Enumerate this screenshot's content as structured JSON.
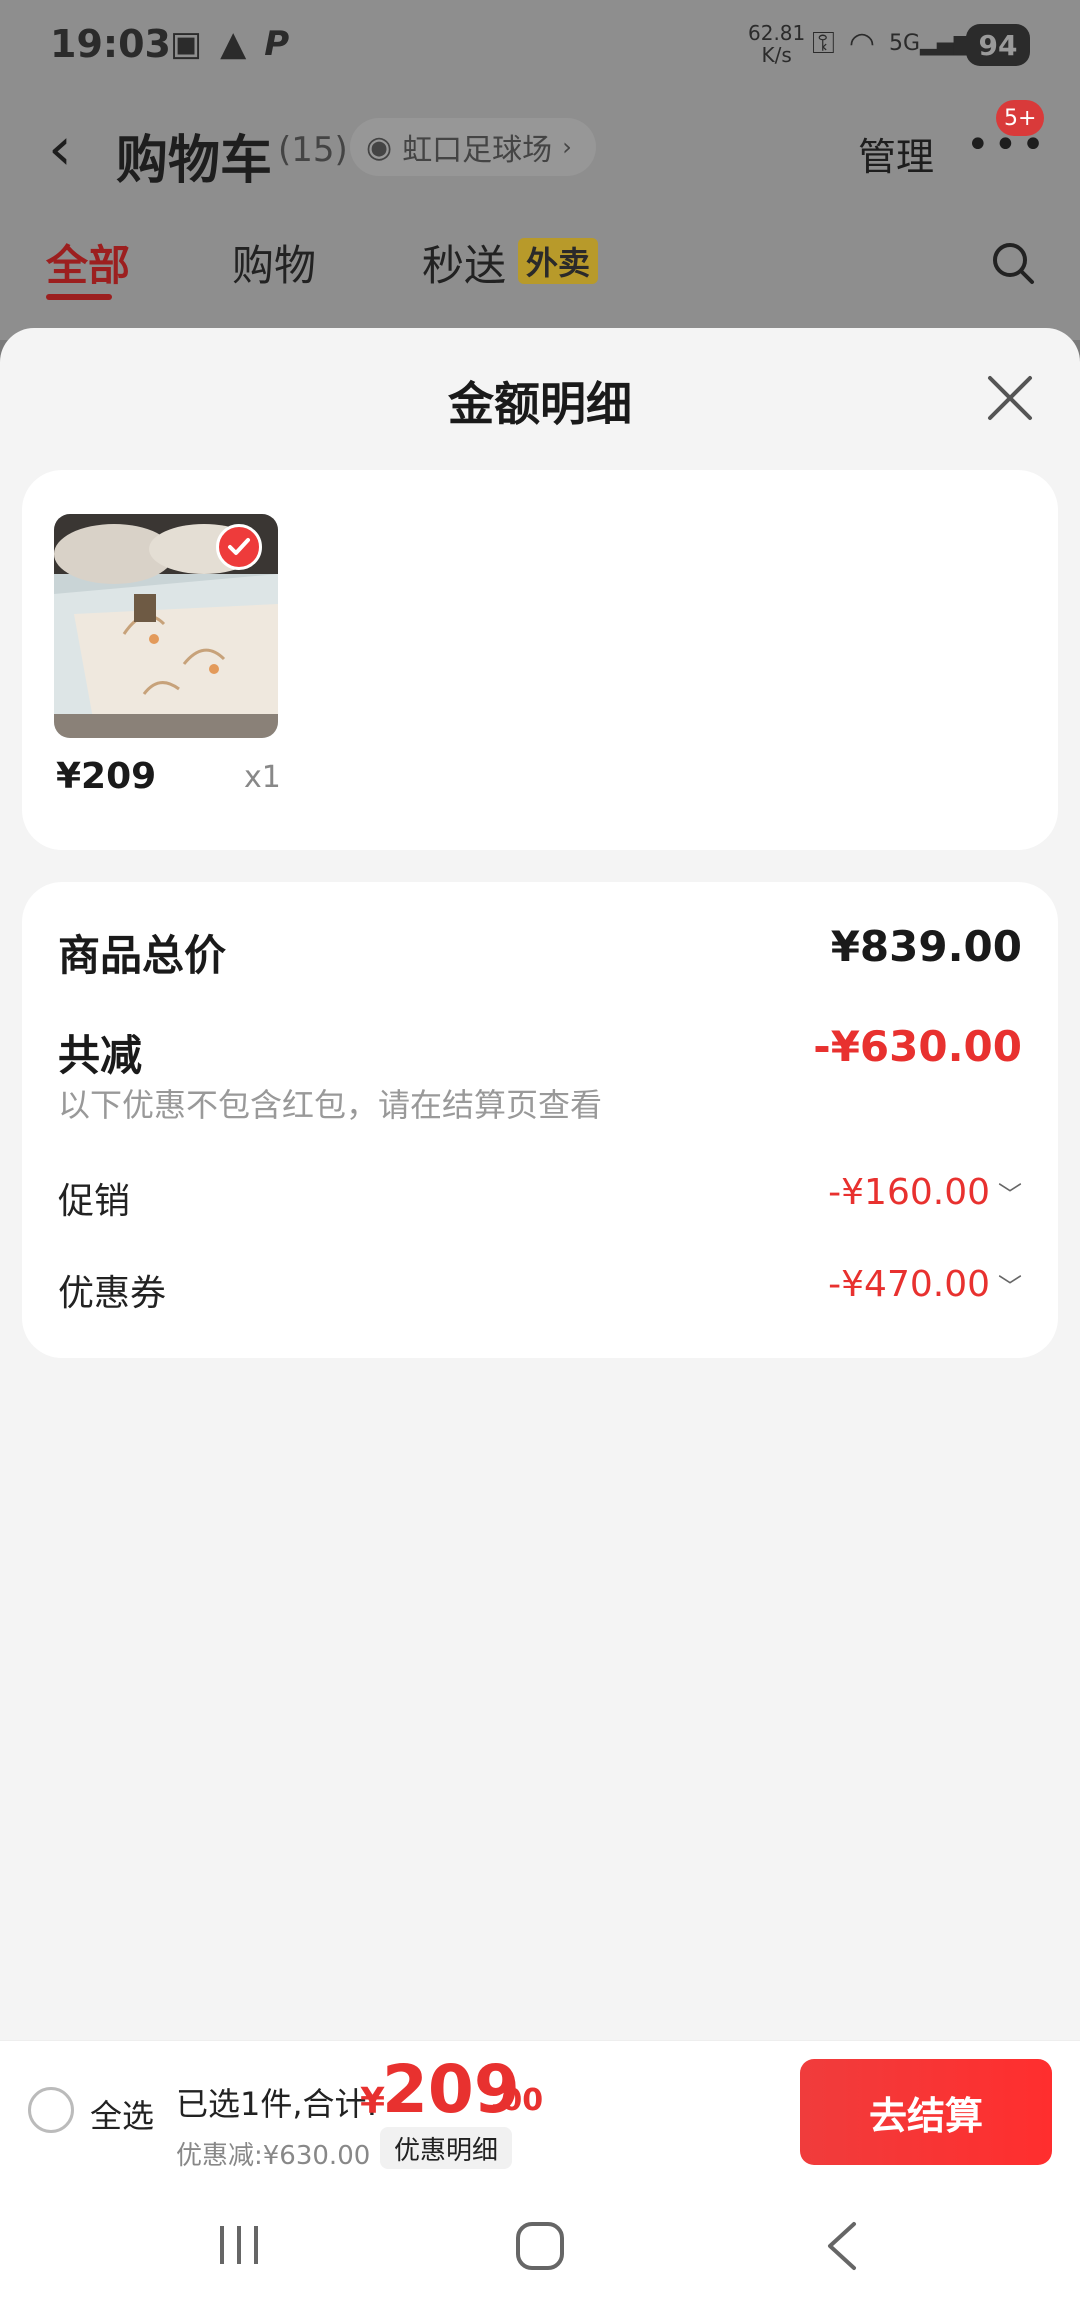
{
  "status_bar": {
    "time": "19:03",
    "speed_value": "62.81",
    "speed_unit": "K/s",
    "network": "5G",
    "battery": "94"
  },
  "header": {
    "title": "购物车",
    "count": "(15)",
    "location": "虹口足球场",
    "manage": "管理",
    "badge": "5+"
  },
  "tabs": {
    "all": "全部",
    "shopping": "购物",
    "express": "秒送",
    "express_tag": "外卖"
  },
  "sheet": {
    "title": "金额明细",
    "item": {
      "price": "¥209",
      "qty": "x1"
    },
    "total_label": "商品总价",
    "total_amount": "¥839.00",
    "reduce_label": "共减",
    "reduce_amount": "-¥630.00",
    "note": "以下优惠不包含红包，请在结算页查看",
    "promo_label": "促销",
    "promo_amount": "-¥160.00",
    "coupon_label": "优惠券",
    "coupon_amount": "-¥470.00"
  },
  "bottom_bar": {
    "select_all": "全选",
    "selected": "已选1件,合计:",
    "currency": "¥",
    "total_int": "209",
    "total_dec": ".00",
    "discount": "优惠减:¥630.00",
    "detail_chip": "优惠明细",
    "checkout": "去结算"
  },
  "colors": {
    "accent_red": "#e8312f",
    "tab_active": "#9c1f1f"
  }
}
